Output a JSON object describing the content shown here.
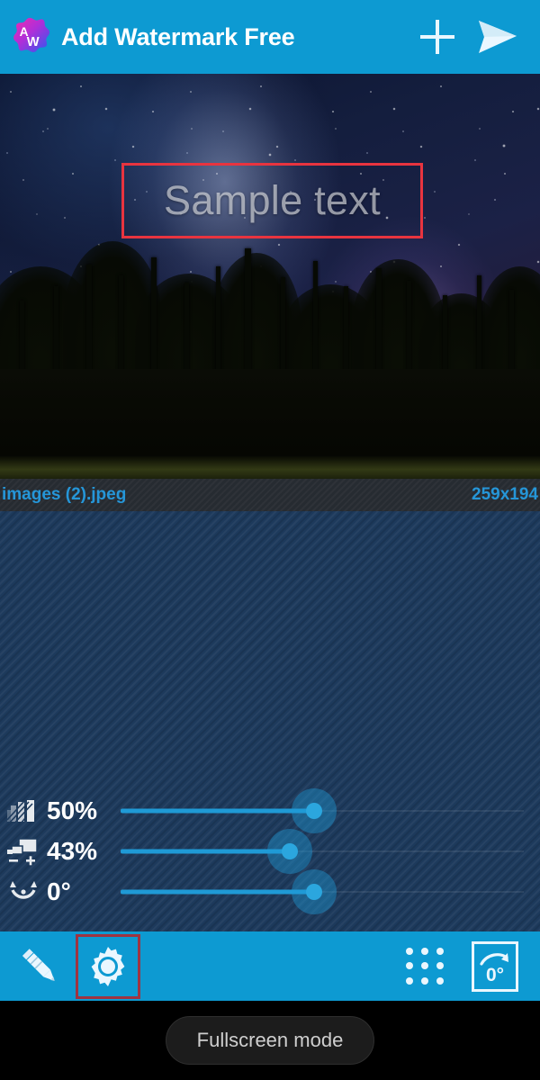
{
  "header": {
    "app_name": "Add Watermark Free",
    "logo_letters": "AW",
    "logo_icon": "app-logo-flower",
    "add_icon": "plus-icon",
    "send_icon": "send-plane-icon",
    "bar_color": "#0d9ad2"
  },
  "canvas": {
    "photo_description": "night sky milky way over pine forest",
    "watermark": {
      "text": "Sample text",
      "selection_border_color": "#e8343f",
      "text_color": "rgba(230,232,236,0.62)"
    }
  },
  "file_info": {
    "filename": "images (2).jpeg",
    "dimensions": "259x194",
    "text_color": "#2596d8"
  },
  "sliders": [
    {
      "icon": "transparency-icon",
      "label": "50%",
      "value": 50,
      "unit": "%",
      "fill_percent": 48,
      "name": "opacity-slider"
    },
    {
      "icon": "resize-icon",
      "label": "43%",
      "value": 43,
      "unit": "%",
      "fill_percent": 42,
      "name": "size-slider"
    },
    {
      "icon": "rotation-icon",
      "label": "0°",
      "value": 0,
      "unit": "°",
      "fill_percent": 48,
      "name": "rotation-slider"
    }
  ],
  "toolbar": {
    "pencil_icon": "pencil-icon",
    "gear_icon": "gear-icon",
    "gear_highlight_color": "#9e3441",
    "grid_icon": "dot-grid-icon",
    "rotate_icon": "rotate-icon",
    "rotate_value": "0°",
    "bar_color": "#0d9ad2"
  },
  "toast": {
    "message": "Fullscreen mode"
  }
}
